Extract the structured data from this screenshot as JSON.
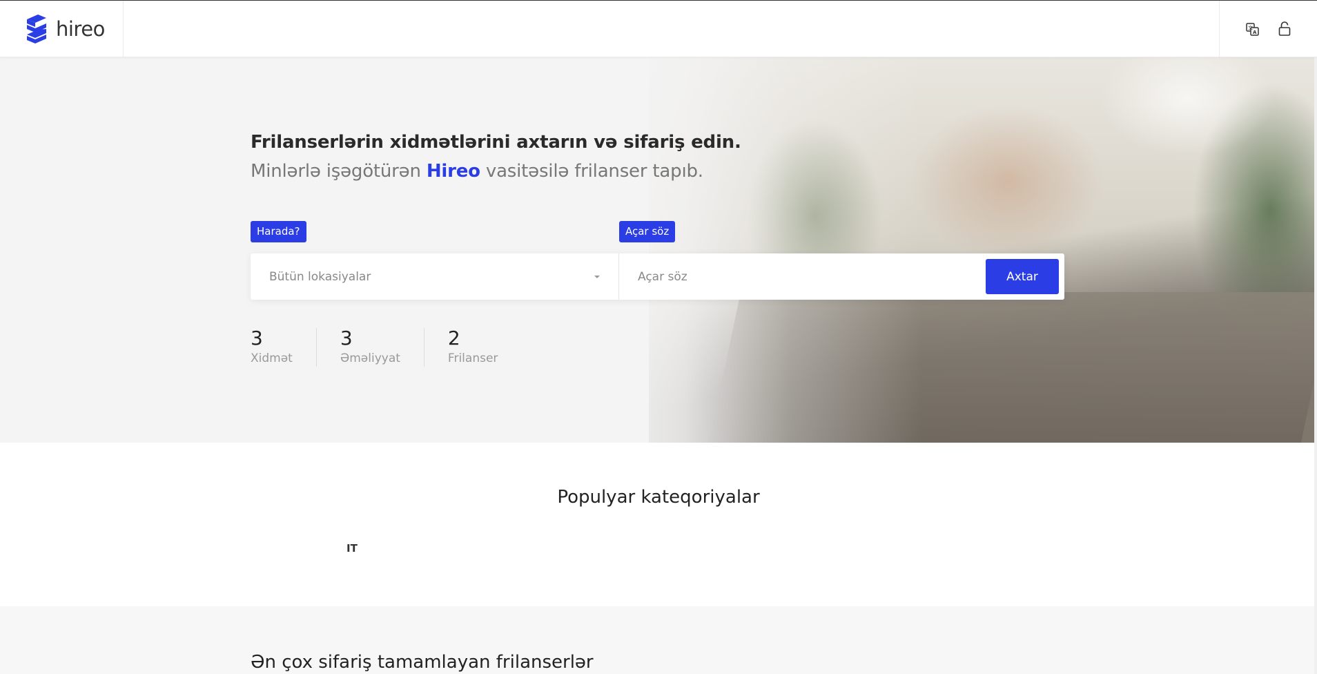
{
  "header": {
    "logo_text": "hireo",
    "icons": [
      "translate-icon",
      "unlock-icon"
    ]
  },
  "hero": {
    "title": "Frilanserlərin xidmətlərini axtarın və sifariş edin.",
    "subtitle_before": "Minlərlə işəgötürən ",
    "subtitle_brand": "Hireo",
    "subtitle_after": " vasitəsilə frilanser tapıb.",
    "tag_where": "Harada?",
    "tag_keyword": "Açar söz",
    "location_value": "Bütün lokasiyalar",
    "keyword_placeholder": "Açar söz",
    "search_button": "Axtar",
    "stats": [
      {
        "value": "3",
        "label": "Xidmət"
      },
      {
        "value": "3",
        "label": "Əməliyyat"
      },
      {
        "value": "2",
        "label": "Frilanser"
      }
    ]
  },
  "categories": {
    "title": "Populyar kateqoriyalar",
    "items": [
      "IT"
    ]
  },
  "bottom": {
    "title": "Ən çox sifariş tamamlayan frilanserlər"
  },
  "colors": {
    "accent": "#2b3ee6"
  }
}
